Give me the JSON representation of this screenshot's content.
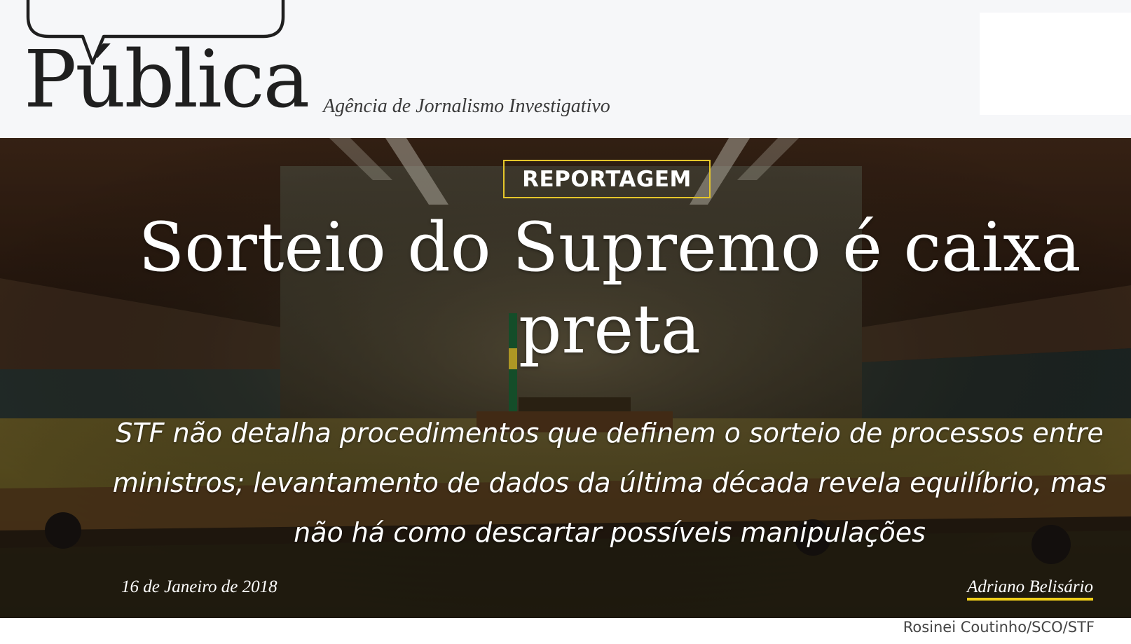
{
  "header": {
    "logo_text": "Pública",
    "tagline": "Agência de Jornalismo Investigativo"
  },
  "article": {
    "section": "REPORTAGEM",
    "title": "Sorteio do Supremo é caixa preta",
    "subtitle": "STF não detalha procedimentos que definem o sorteio de processos entre ministros; levantamento de dados da última década revela equilíbrio, mas não há como descartar possíveis manipulações",
    "date": "16 de Janeiro de 2018",
    "author": "Adriano Belisário",
    "photo_credit": "Rosinei Coutinho/SCO/STF"
  },
  "colors": {
    "accent": "#e5c62a",
    "header_bg": "#f6f7f9"
  }
}
